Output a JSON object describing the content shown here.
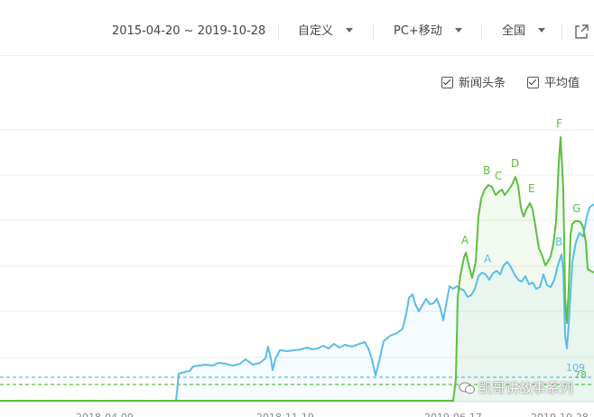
{
  "toolbar": {
    "date_range": "2015-04-20 ~ 2019-10-28",
    "period": "自定义",
    "platform": "PC+移动",
    "region": "全国"
  },
  "legend": {
    "series_1": "新闻头条",
    "series_2": "平均值"
  },
  "watermark": "凯哥讲故事系列",
  "colors": {
    "green": "#5bbf3f",
    "blue": "#5bbde9",
    "grid": "#ececec"
  },
  "chart_data": {
    "type": "line",
    "x_ticks": [
      "2018-04-09",
      "2018-11-19",
      "2019-06-17",
      "2019-10-28"
    ],
    "series": [
      {
        "name": "新闻头条",
        "color": "#5bbf3f",
        "end_label": "78",
        "baseline_value": 78,
        "annotations": [
          "A",
          "B",
          "C",
          "D",
          "E",
          "F",
          "G"
        ]
      },
      {
        "name": "平均值",
        "color": "#5bbde9",
        "end_label": "109",
        "baseline_value": 109,
        "annotations": [
          "A",
          "B"
        ]
      }
    ],
    "grid": true
  }
}
